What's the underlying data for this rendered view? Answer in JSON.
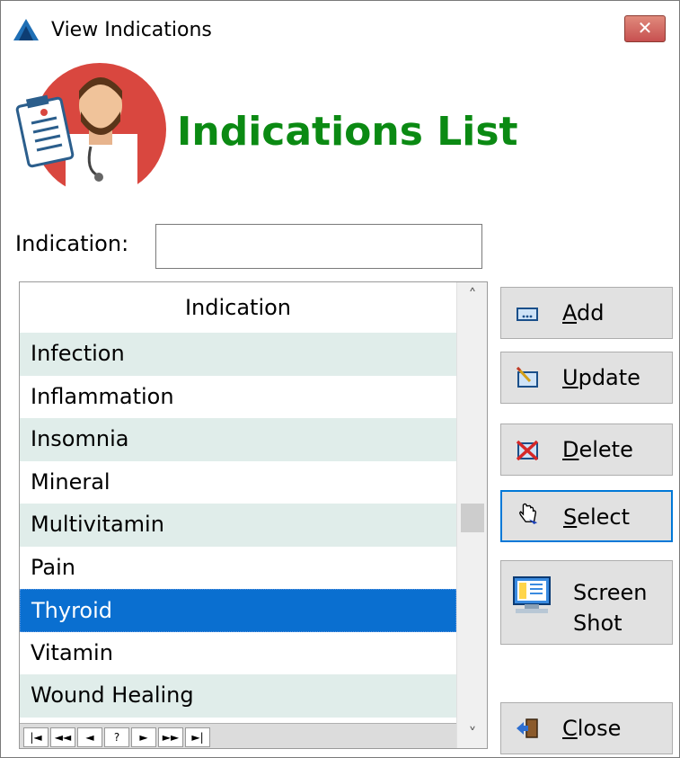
{
  "window": {
    "title": "View Indications",
    "close_glyph": "✕"
  },
  "header": {
    "heading": "Indications List",
    "avatar_icon": "doctor-avatar-icon"
  },
  "search": {
    "label": "Indication:",
    "value": "",
    "placeholder": ""
  },
  "grid": {
    "column_header": "Indication",
    "rows": [
      "Infection",
      "Inflammation",
      "Insomnia",
      "Mineral",
      "Multivitamin",
      "Pain",
      "Thyroid",
      "Vitamin",
      "Wound Healing"
    ],
    "selected_row": "Thyroid",
    "nav_buttons": [
      "|◄",
      "◄◄",
      "◄",
      "?",
      "►",
      "►►",
      "►|"
    ],
    "scroll_up": "˄",
    "scroll_down": "˅"
  },
  "buttons": {
    "add": "Add",
    "update": "Update",
    "delete": "Delete",
    "select": "Select",
    "screenshot": "Screen\nShot",
    "close": "Close"
  },
  "colors": {
    "heading": "#0b8a13",
    "selected_row": "#0a6fd0",
    "alt_row": "#e0edea",
    "focus_border": "#0078d7"
  }
}
